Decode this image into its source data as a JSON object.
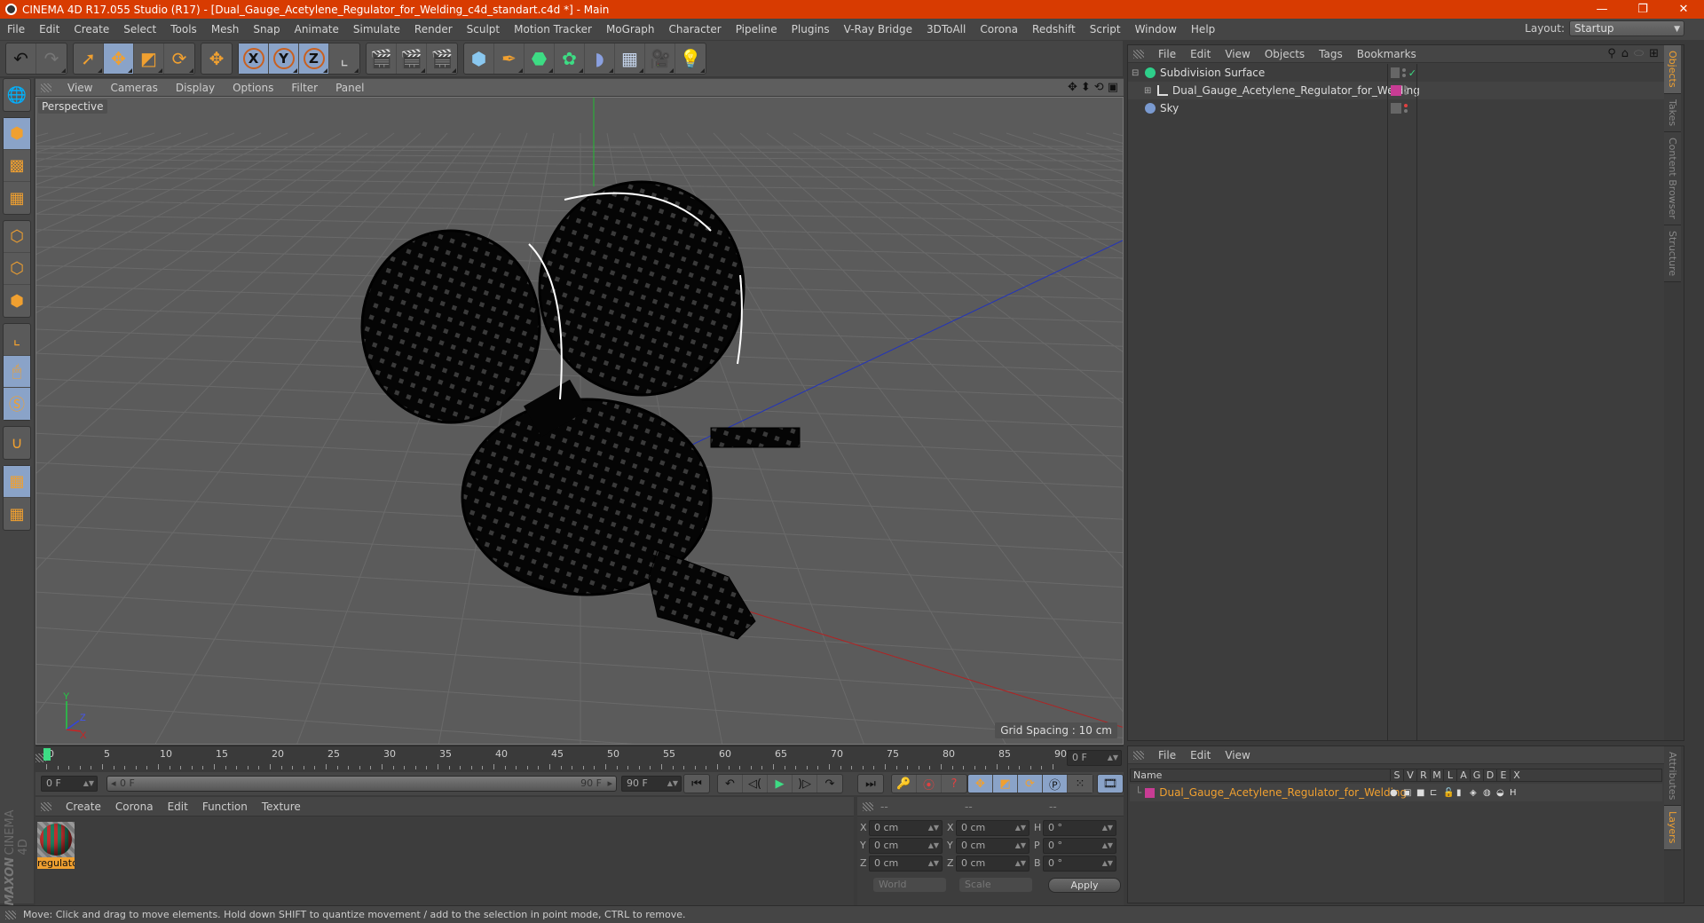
{
  "window": {
    "title": "CINEMA 4D R17.055 Studio (R17) - [Dual_Gauge_Acetylene_Regulator_for_Welding_c4d_standart.c4d *] - Main",
    "controls": [
      "—",
      "❐",
      "✕"
    ]
  },
  "menubar": {
    "items": [
      "File",
      "Edit",
      "Create",
      "Select",
      "Tools",
      "Mesh",
      "Snap",
      "Animate",
      "Simulate",
      "Render",
      "Sculpt",
      "Motion Tracker",
      "MoGraph",
      "Character",
      "Pipeline",
      "Plugins",
      "V-Ray Bridge",
      "3DToAll",
      "Corona",
      "Redshift",
      "Script",
      "Window",
      "Help"
    ],
    "layout_label": "Layout:",
    "layout_value": "Startup"
  },
  "toolbar": {
    "groups": [
      [
        {
          "name": "undo",
          "glyph": "↶"
        },
        {
          "name": "redo",
          "glyph": "↷"
        }
      ],
      [
        {
          "name": "live-selection",
          "glyph": "➚",
          "on": false
        },
        {
          "name": "move",
          "glyph": "✥",
          "on": true
        },
        {
          "name": "scale",
          "glyph": "◩"
        },
        {
          "name": "rotate",
          "glyph": "⟳"
        }
      ],
      [
        {
          "name": "move-tool-2",
          "glyph": "✥"
        }
      ],
      [
        {
          "name": "x-axis",
          "glyph": "X",
          "on": true
        },
        {
          "name": "y-axis",
          "glyph": "Y",
          "on": true
        },
        {
          "name": "z-axis",
          "glyph": "Z",
          "on": true
        },
        {
          "name": "coordinate-system",
          "glyph": "⌞"
        }
      ],
      [
        {
          "name": "render-view",
          "glyph": "🎬"
        },
        {
          "name": "render-picture-viewer",
          "glyph": "🎬"
        },
        {
          "name": "edit-render-settings",
          "glyph": "🎬"
        }
      ],
      [
        {
          "name": "cube",
          "glyph": "⬢"
        },
        {
          "name": "pen-spline",
          "glyph": "✒"
        },
        {
          "name": "subdivision-surface",
          "glyph": "⬣"
        },
        {
          "name": "cloner",
          "glyph": "✿"
        },
        {
          "name": "bend-deformer",
          "glyph": "◗"
        },
        {
          "name": "floor",
          "glyph": "▦"
        },
        {
          "name": "camera",
          "glyph": "🎥"
        },
        {
          "name": "light",
          "glyph": "💡"
        }
      ]
    ]
  },
  "left_toolbar": {
    "groups": [
      [
        {
          "name": "make-editable",
          "glyph": "🌐"
        }
      ],
      [
        {
          "name": "model-mode",
          "glyph": "⬢",
          "on": true
        },
        {
          "name": "texture-mode",
          "glyph": "▩"
        },
        {
          "name": "workplane-mode",
          "glyph": "▦"
        }
      ],
      [
        {
          "name": "points-mode",
          "glyph": "⬡"
        },
        {
          "name": "edges-mode",
          "glyph": "⬡"
        },
        {
          "name": "polygons-mode",
          "glyph": "⬢"
        }
      ],
      [
        {
          "name": "enable-axis",
          "glyph": "⌞"
        },
        {
          "name": "tweak-mode",
          "glyph": "🖱",
          "on": true
        },
        {
          "name": "solo-mode",
          "glyph": "Ⓢ",
          "on": true
        }
      ],
      [
        {
          "name": "snap",
          "glyph": "∪"
        }
      ],
      [
        {
          "name": "workplane-lock",
          "glyph": "▦",
          "on": true
        },
        {
          "name": "workplane-align",
          "glyph": "▦"
        }
      ]
    ]
  },
  "viewport": {
    "menu": [
      "View",
      "Cameras",
      "Display",
      "Options",
      "Filter",
      "Panel"
    ],
    "camera_label": "Perspective",
    "grid_spacing": "Grid Spacing : 10 cm",
    "axis_labels": {
      "x": "X",
      "y": "Y",
      "z": "Z"
    },
    "nav_icons": [
      "✥",
      "⬍",
      "⟲",
      "▣"
    ]
  },
  "timeline": {
    "ticks": [
      0,
      5,
      10,
      15,
      20,
      25,
      30,
      35,
      40,
      45,
      50,
      55,
      60,
      65,
      70,
      75,
      80,
      85,
      90
    ],
    "current_frame": "0 F",
    "range_start": "0 F",
    "range_slider_start": "0 F",
    "range_slider_end": "90 F",
    "range_end": "90 F",
    "playhead_value": 0,
    "max_frame": 90
  },
  "playback": {
    "nav": [
      "⏮"
    ],
    "transport": [
      "↶",
      "◁(",
      "▶",
      ")▷",
      "↷"
    ],
    "end": [
      "⏭"
    ],
    "keys": [
      "🔑",
      "⦿",
      "?"
    ],
    "key_modes": [
      "✥",
      "◩",
      "⟳",
      "Ⓟ",
      "⁙"
    ],
    "timeline_btn": "🎞"
  },
  "materials": {
    "menu": [
      "Create",
      "Corona",
      "Edit",
      "Function",
      "Texture"
    ],
    "items": [
      {
        "name": "regulato"
      }
    ],
    "brand_top": "MAXON",
    "brand_bottom": "CINEMA 4D"
  },
  "coordinates": {
    "headers": [
      "--",
      "--",
      "--"
    ],
    "rows": [
      {
        "a": "X",
        "av": "0 cm",
        "b": "X",
        "bv": "0 cm",
        "c": "H",
        "cv": "0 °"
      },
      {
        "a": "Y",
        "av": "0 cm",
        "b": "Y",
        "bv": "0 cm",
        "c": "P",
        "cv": "0 °"
      },
      {
        "a": "Z",
        "av": "0 cm",
        "b": "Z",
        "bv": "0 cm",
        "c": "B",
        "cv": "0 °"
      }
    ],
    "space_select": "World",
    "mode_select": "Scale",
    "apply_label": "Apply"
  },
  "objects": {
    "menu": [
      "File",
      "Edit",
      "View",
      "Objects",
      "Tags",
      "Bookmarks"
    ],
    "items": [
      {
        "name": "Subdivision Surface",
        "icon": "subdivision-icon",
        "expander": "⊟",
        "color": "#2ecf8a"
      },
      {
        "name": "Dual_Gauge_Acetylene_Regulator_for_Welding",
        "icon": "null-icon",
        "expander": "⊞",
        "layer_color": "#c83c94"
      },
      {
        "name": "Sky",
        "icon": "sky-icon",
        "expander": "",
        "color": "#7a9ad0"
      }
    ],
    "side_tabs": [
      "Objects",
      "Takes",
      "Content Browser",
      "Structure"
    ]
  },
  "layers": {
    "menu": [
      "File",
      "Edit",
      "View"
    ],
    "columns": [
      "Name",
      "S",
      "V",
      "R",
      "M",
      "L",
      "A",
      "G",
      "D",
      "E",
      "X"
    ],
    "items": [
      {
        "name": "Dual_Gauge_Acetylene_Regulator_for_Welding",
        "color": "#c83c94"
      }
    ],
    "side_tabs": [
      "Attributes",
      "Layers"
    ]
  },
  "status": {
    "text": "Move: Click and drag to move elements. Hold down SHIFT to quantize movement / add to the selection in point mode, CTRL to remove."
  },
  "colors": {
    "title_bar": "#d83b01",
    "accent_orange": "#f0a030",
    "active_blue": "#8aa3c8",
    "axis_x": "#b22222",
    "axis_y": "#22bb33",
    "axis_z": "#2233bb",
    "playhead": "#3ddc84"
  }
}
